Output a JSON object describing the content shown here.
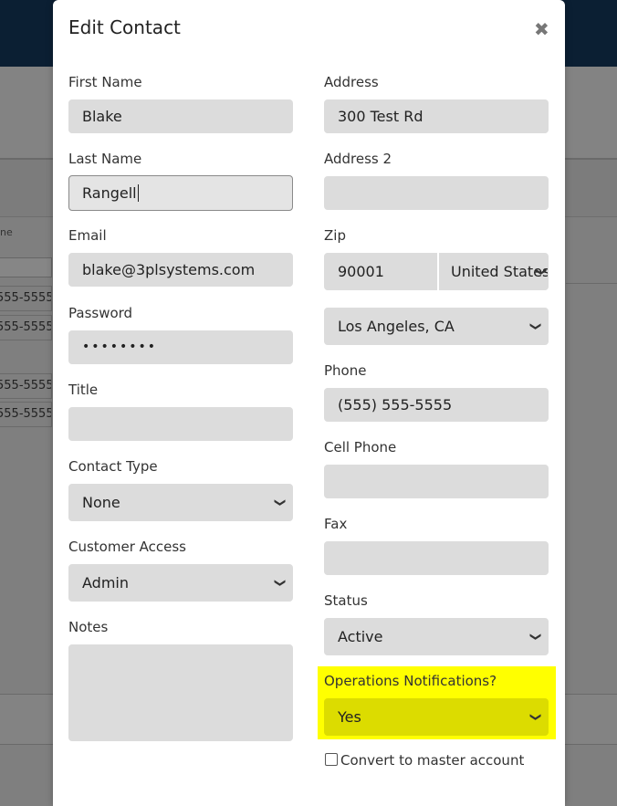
{
  "background": {
    "table_col_header": "ne",
    "phone_cells": [
      "555-5555",
      "555-5555",
      "555-5555",
      "555-5555"
    ]
  },
  "modal": {
    "title": "Edit Contact",
    "close_icon": "close-icon",
    "left": {
      "first_name": {
        "label": "First Name",
        "value": "Blake"
      },
      "last_name": {
        "label": "Last Name",
        "value": "Rangell"
      },
      "email": {
        "label": "Email",
        "value": "blake@3plsystems.com"
      },
      "password": {
        "label": "Password",
        "value": "••••••••"
      },
      "title": {
        "label": "Title",
        "value": ""
      },
      "contact_type": {
        "label": "Contact Type",
        "value": "None"
      },
      "customer_access": {
        "label": "Customer Access",
        "value": "Admin"
      },
      "notes": {
        "label": "Notes",
        "value": ""
      }
    },
    "right": {
      "address": {
        "label": "Address",
        "value": "300 Test Rd"
      },
      "address2": {
        "label": "Address 2",
        "value": ""
      },
      "zip": {
        "label": "Zip",
        "value": "90001"
      },
      "country": {
        "value": "United States"
      },
      "city_state": {
        "value": "Los Angeles, CA"
      },
      "phone": {
        "label": "Phone",
        "value": "(555) 555-5555"
      },
      "cell_phone": {
        "label": "Cell Phone",
        "value": ""
      },
      "fax": {
        "label": "Fax",
        "value": ""
      },
      "status": {
        "label": "Status",
        "value": "Active"
      },
      "operations_notifications": {
        "label": "Operations Notifications?",
        "value": "Yes"
      },
      "convert_master": {
        "label": "Convert to master account",
        "checked": false
      }
    },
    "highlight_color": "#ffff00"
  }
}
